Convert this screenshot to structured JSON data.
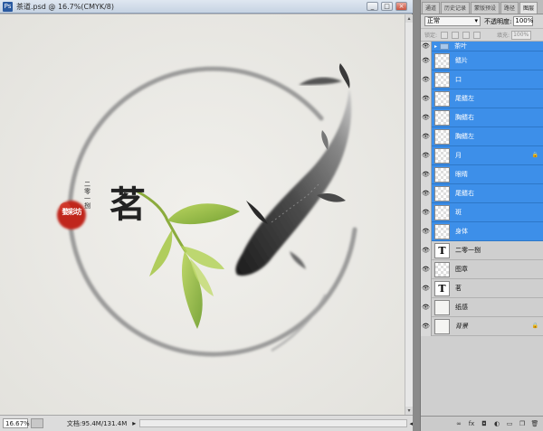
{
  "document": {
    "title": "茶道.psd @ 16.7%(CMYK/8)",
    "ps_badge": "Ps",
    "window_buttons": {
      "min": "_",
      "max": "□",
      "close": "×"
    }
  },
  "artwork": {
    "title_glyph": "茗",
    "vertical_text": "二零一捌",
    "seal_text": "婺彩坊"
  },
  "status": {
    "zoom": "16.67%",
    "doc_size": "文档:95.4M/131.4M",
    "arrow": "▸",
    "right_arrow": "◂"
  },
  "panel": {
    "tabs": [
      {
        "label": "通道",
        "active": false
      },
      {
        "label": "历史记录",
        "active": false
      },
      {
        "label": "蒙版预设",
        "active": false
      },
      {
        "label": "路径",
        "active": false
      },
      {
        "label": "图层",
        "active": true
      }
    ],
    "blend_mode": "正常",
    "opacity_label": "不透明度:",
    "opacity_value": "100%",
    "lock_label": "锁定:",
    "fill_label": "填充:",
    "fill_value": "100%"
  },
  "layers": [
    {
      "name": "茶叶",
      "kind": "group",
      "selected": true
    },
    {
      "name": "鳍片",
      "kind": "raster",
      "selected": true
    },
    {
      "name": "口",
      "kind": "raster",
      "selected": true
    },
    {
      "name": "尾鳍左",
      "kind": "raster",
      "selected": true
    },
    {
      "name": "胸鳍右",
      "kind": "raster",
      "selected": true
    },
    {
      "name": "胸鳍左",
      "kind": "raster",
      "selected": true
    },
    {
      "name": "月",
      "kind": "raster",
      "selected": true,
      "locked": true
    },
    {
      "name": "眼睛",
      "kind": "raster",
      "selected": true
    },
    {
      "name": "尾鳍右",
      "kind": "raster",
      "selected": true
    },
    {
      "name": "斑",
      "kind": "raster",
      "selected": true
    },
    {
      "name": "身体",
      "kind": "raster",
      "selected": true
    },
    {
      "name": "二零一捌",
      "kind": "type",
      "selected": false
    },
    {
      "name": "图章",
      "kind": "raster",
      "selected": false
    },
    {
      "name": "茗",
      "kind": "type",
      "selected": false
    },
    {
      "name": "纸感",
      "kind": "plain",
      "selected": false
    },
    {
      "name": "背景",
      "kind": "background",
      "selected": false,
      "locked": true
    }
  ],
  "icons": {
    "eye": "eye-icon",
    "lock": "lock-icon",
    "bottom": [
      "link-icon",
      "fx-icon",
      "mask-icon",
      "adjustment-icon",
      "folder-icon",
      "new-layer-icon",
      "trash-icon"
    ]
  }
}
